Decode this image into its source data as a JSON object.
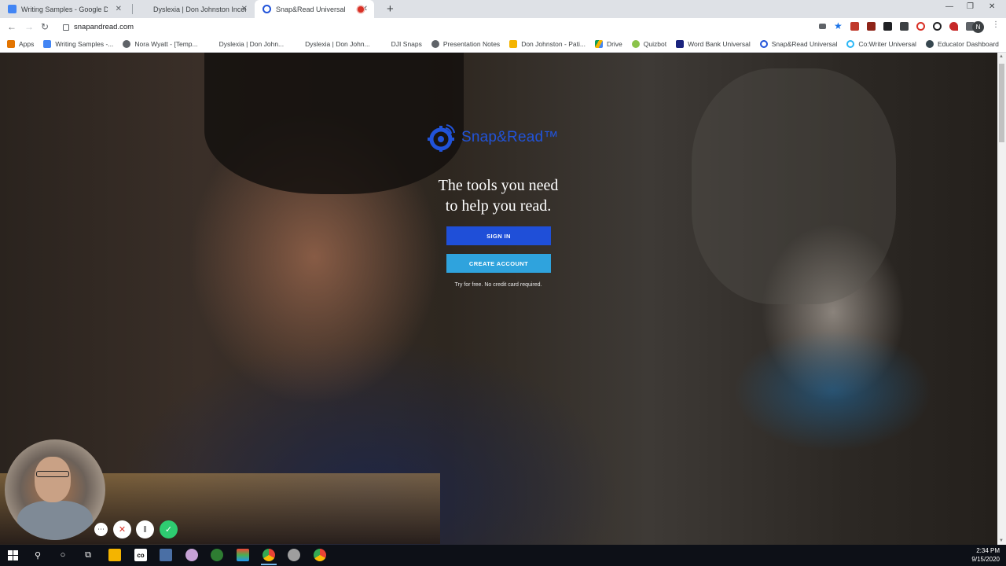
{
  "browser": {
    "tabs": [
      {
        "title": "Writing Samples - Google Docs",
        "icon": "google-docs-icon",
        "color": "#4285f4",
        "active": false
      },
      {
        "title": "Dyslexia | Don Johnston Incorpor",
        "icon": "dji-icon",
        "color": "#dee1e6",
        "active": false
      },
      {
        "title": "Snap&Read Universal",
        "icon": "snapread-icon",
        "color": "#2153d9",
        "active": true
      }
    ],
    "url": "snapandread.com",
    "profile_initial": "N",
    "bookmarks": [
      {
        "label": "Apps",
        "icon": "apps-grid-icon",
        "color": "#e37400"
      },
      {
        "label": "Writing Samples -...",
        "icon": "google-docs-icon",
        "color": "#4285f4"
      },
      {
        "label": "Nora Wyatt - [Temp...",
        "icon": "globe-icon",
        "color": "#5f6368"
      },
      {
        "label": "Dyslexia | Don John...",
        "icon": "blank-page-icon",
        "color": "#ffffff"
      },
      {
        "label": "Dyslexia | Don John...",
        "icon": "blank-page-icon",
        "color": "#ffffff"
      },
      {
        "label": "DJI Snaps",
        "icon": "blank-page-icon",
        "color": "#ffffff"
      },
      {
        "label": "Presentation Notes",
        "icon": "globe-icon",
        "color": "#5f6368"
      },
      {
        "label": "Don Johnston - Pati...",
        "icon": "folder-icon",
        "color": "#f4b400"
      },
      {
        "label": "Drive",
        "icon": "google-drive-icon",
        "color": "#0f9d58"
      },
      {
        "label": "Quizbot",
        "icon": "quizbot-icon",
        "color": "#8bc34a"
      },
      {
        "label": "Word Bank Universal",
        "icon": "wordbank-icon",
        "color": "#1a237e"
      },
      {
        "label": "Snap&Read Universal",
        "icon": "snapread-icon",
        "color": "#2153d9"
      },
      {
        "label": "Co:Writer Universal",
        "icon": "cowriter-icon",
        "color": "#29b6f6"
      },
      {
        "label": "Educator Dashboard",
        "icon": "dashboard-icon",
        "color": "#37474f"
      }
    ]
  },
  "hero": {
    "logo_text": "Snap&Read™",
    "tagline_line1": "The tools you need",
    "tagline_line2": "to help you read.",
    "sign_in": "SIGN IN",
    "create_account": "CREATE ACCOUNT",
    "trial_note": "Try for free. No credit card required."
  },
  "recorder": {
    "more": "⋯",
    "cancel": "✕",
    "pause": "‖",
    "done": "✓"
  },
  "taskbar": {
    "time": "2:34 PM",
    "date": "9/15/2020"
  },
  "colors": {
    "brand_blue": "#1f4fd8",
    "accent_light_blue": "#2fa3dd"
  }
}
